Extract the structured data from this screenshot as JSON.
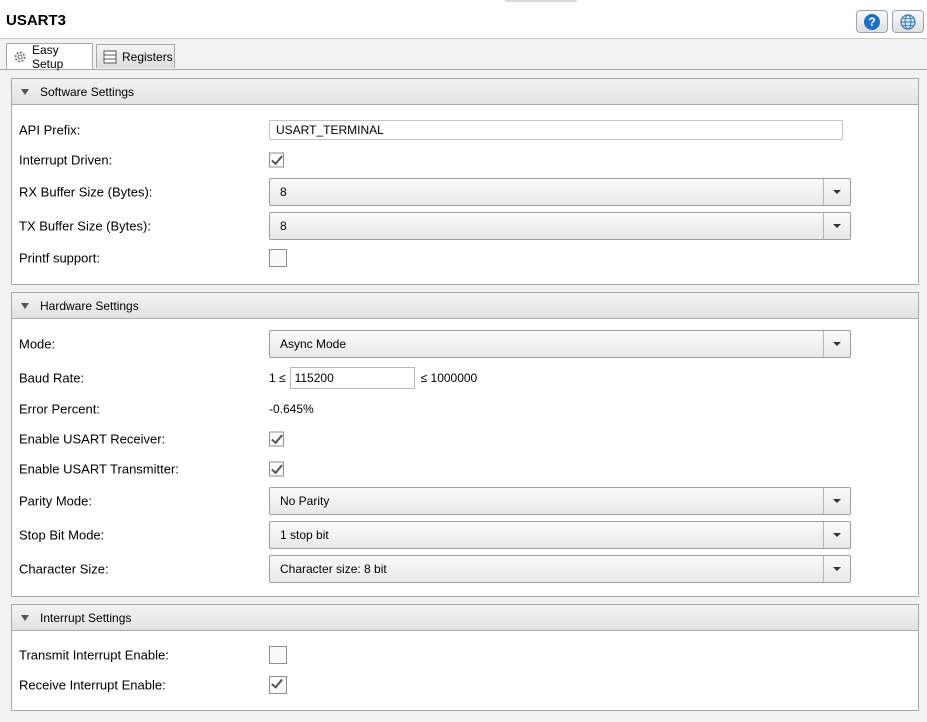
{
  "window": {
    "title": "USART3"
  },
  "toolbar": {
    "help_icon": "help-icon",
    "web_icon": "globe-icon",
    "help_glyph": "?"
  },
  "tabs": [
    {
      "label": "Easy Setup",
      "icon": "gear-icon",
      "active": true
    },
    {
      "label": "Registers",
      "icon": "table-icon",
      "active": false
    }
  ],
  "software": {
    "header": "Software Settings",
    "api_prefix": {
      "label": "API Prefix:",
      "value": "USART_TERMINAL"
    },
    "interrupt_driven": {
      "label": "Interrupt Driven:",
      "checked": true
    },
    "rx_buffer": {
      "label": "RX Buffer Size (Bytes):",
      "value": "8"
    },
    "tx_buffer": {
      "label": "TX Buffer Size (Bytes):",
      "value": "8"
    },
    "printf_support": {
      "label": "Printf support:",
      "checked": false
    }
  },
  "hardware": {
    "header": "Hardware Settings",
    "mode": {
      "label": "Mode:",
      "value": "Async Mode"
    },
    "baud_rate": {
      "label": "Baud Rate:",
      "min_text": "1 ≤",
      "value": "115200",
      "max_text": "≤ 1000000"
    },
    "error_percent": {
      "label": "Error Percent:",
      "value": "-0.645%"
    },
    "enable_receiver": {
      "label": "Enable USART Receiver:",
      "checked": true
    },
    "enable_transmitter": {
      "label": "Enable USART Transmitter:",
      "checked": true
    },
    "parity_mode": {
      "label": "Parity Mode:",
      "value": "No Parity"
    },
    "stop_bit_mode": {
      "label": "Stop Bit Mode:",
      "value": "1 stop bit"
    },
    "character_size": {
      "label": "Character Size:",
      "value": "Character size: 8 bit"
    }
  },
  "interrupts": {
    "header": "Interrupt Settings",
    "transmit_enable": {
      "label": "Transmit Interrupt Enable:",
      "checked": false
    },
    "receive_enable": {
      "label": "Receive Interrupt Enable:",
      "checked": true
    }
  }
}
